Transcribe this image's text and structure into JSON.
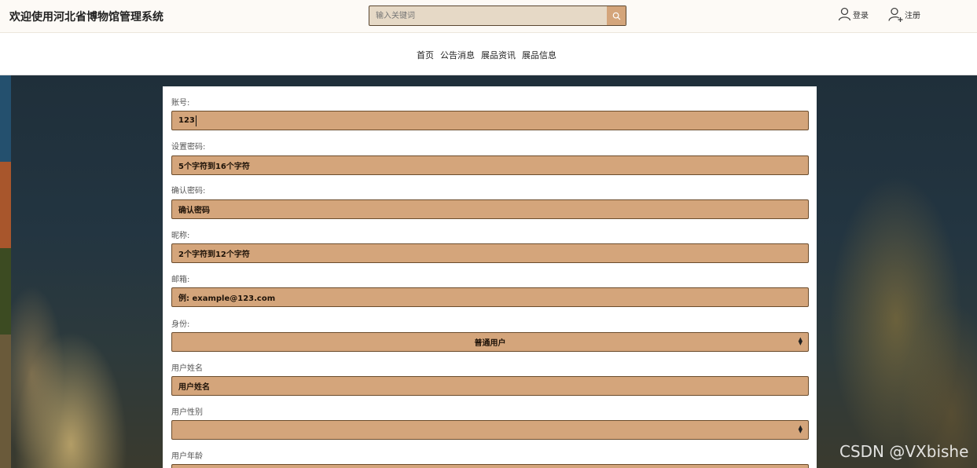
{
  "header": {
    "site_title": "欢迎使用河北省博物馆管理系统",
    "search_placeholder": "输入关键词",
    "login_label": "登录",
    "register_label": "注册"
  },
  "nav": {
    "items": [
      "首页",
      "公告消息",
      "展品资讯",
      "展品信息"
    ]
  },
  "form": {
    "fields": [
      {
        "label": "账号:",
        "value": "123"
      },
      {
        "label": "设置密码:",
        "value": "5个字符到16个字符"
      },
      {
        "label": "确认密码:",
        "value": "确认密码"
      },
      {
        "label": "昵称:",
        "value": "2个字符到12个字符"
      },
      {
        "label": "邮箱:",
        "value": "例: example@123.com"
      },
      {
        "label": "身份:",
        "value": "普通用户"
      },
      {
        "label": "用户姓名",
        "value": "用户姓名"
      },
      {
        "label": "用户性别",
        "value": ""
      },
      {
        "label": "用户年龄",
        "value": ""
      }
    ]
  },
  "watermark": "CSDN @VXbishe",
  "colors": {
    "field_bg": "#d4a57b",
    "search_bg": "#e6d9c6",
    "search_btn": "#d4a57b"
  }
}
